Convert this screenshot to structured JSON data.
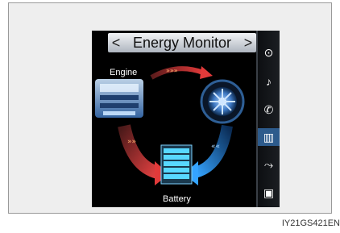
{
  "header": {
    "title": "Energy Monitor",
    "prev_label": "<",
    "next_label": ">"
  },
  "diagram": {
    "engine_label": "Engine",
    "battery_label": "Battery",
    "flows": [
      "engine-to-wheel",
      "engine-to-battery",
      "wheel-to-battery"
    ]
  },
  "sidebar": {
    "items": [
      {
        "name": "navigation-icon",
        "glyph": "⊙"
      },
      {
        "name": "music-icon",
        "glyph": "♪"
      },
      {
        "name": "phone-icon",
        "glyph": "✆"
      },
      {
        "name": "energy-monitor-icon",
        "glyph": "▥",
        "active": true
      },
      {
        "name": "climate-icon",
        "glyph": "⤳"
      },
      {
        "name": "display-icon",
        "glyph": "▣"
      }
    ]
  },
  "caption": "IY21GS421EN",
  "colors": {
    "accent": "#2d5b8c",
    "flow_red": "#d83a3a",
    "flow_blue": "#2a8cff"
  }
}
